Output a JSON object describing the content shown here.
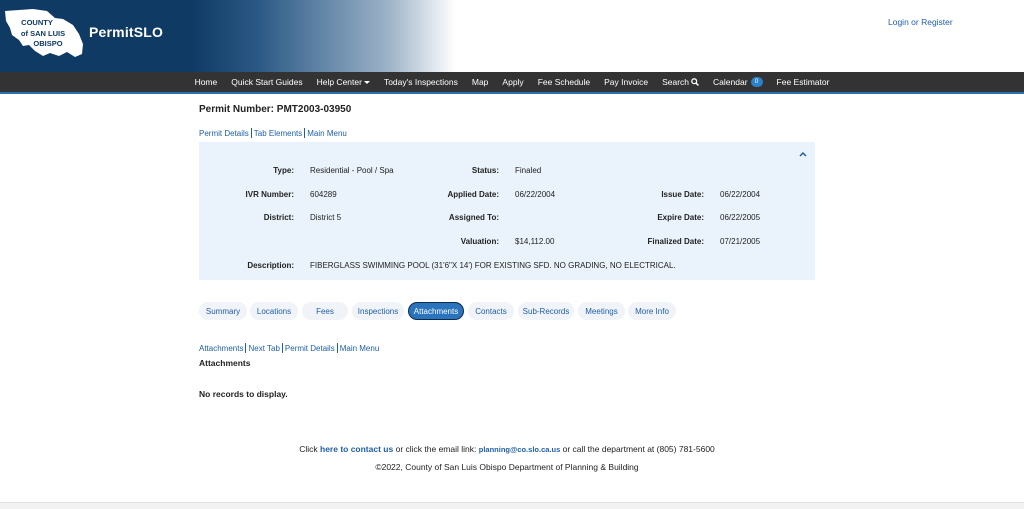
{
  "header": {
    "logo_text": "COUNTY OF SAN LUIS OBISPO",
    "brand": "PermitSLO",
    "login": "Login or Register"
  },
  "nav": {
    "items": [
      "Home",
      "Quick Start Guides",
      "Help Center",
      "Today's Inspections",
      "Map",
      "Apply",
      "Fee Schedule",
      "Pay Invoice",
      "Search",
      "Calendar",
      "Fee Estimator"
    ],
    "calendar_badge": "0"
  },
  "permit": {
    "title": "Permit Number: PMT2003-03950",
    "crumbs": [
      "Permit Details",
      "Tab Elements",
      "Main Menu"
    ],
    "fields": {
      "type_label": "Type:",
      "type": "Residential - Pool / Spa",
      "status_label": "Status:",
      "status": "Finaled",
      "ivr_label": "IVR Number:",
      "ivr": "604289",
      "applied_label": "Applied Date:",
      "applied": "06/22/2004",
      "issue_label": "Issue Date:",
      "issue": "06/22/2004",
      "district_label": "District:",
      "district": "District 5",
      "assigned_label": "Assigned To:",
      "assigned": "",
      "expire_label": "Expire Date:",
      "expire": "06/22/2005",
      "valuation_label": "Valuation:",
      "valuation": "$14,112.00",
      "finalized_label": "Finalized Date:",
      "finalized": "07/21/2005",
      "description_label": "Description:",
      "description": "FIBERGLASS SWIMMING POOL (31'6\"X 14') FOR EXISTING SFD. NO GRADING, NO ELECTRICAL."
    }
  },
  "tabs": {
    "items": [
      "Summary",
      "Locations",
      "Fees",
      "Inspections",
      "Attachments",
      "Contacts",
      "Sub-Records",
      "Meetings",
      "More Info"
    ],
    "active": "Attachments"
  },
  "attachments": {
    "crumbs": [
      "Attachments",
      "Next Tab",
      "Permit Details",
      "Main Menu"
    ],
    "title": "Attachments",
    "empty": "No records to display."
  },
  "footer": {
    "click": "Click",
    "contact_link": "here to contact us",
    "or_email": "or click the email link:",
    "email": "planning@co.slo.ca.us",
    "or_call": "or call the department at (805) 781-5600",
    "copyright": "©2022, County of San Luis Obispo Department of Planning & Building"
  },
  "colors": {
    "header_dark": "#0e3a64",
    "nav_bg": "#333333",
    "link": "#1f5fa8",
    "panel_bg": "#eaf3fb",
    "active_tab": "#2a73bd"
  }
}
